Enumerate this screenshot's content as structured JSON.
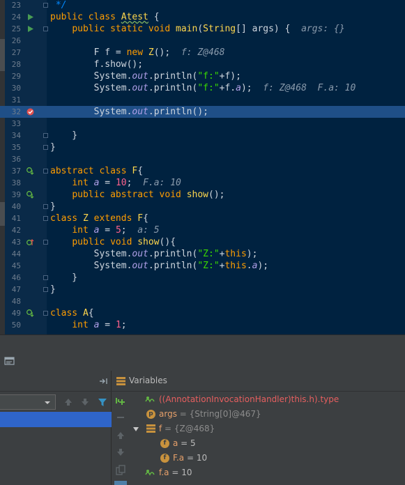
{
  "editor": {
    "lines": [
      {
        "n": "23",
        "code": [
          [
            "c",
            " */"
          ]
        ]
      },
      {
        "n": "24",
        "code": [
          [
            "k",
            "public class "
          ],
          [
            "w",
            "Atest"
          ],
          [
            "p",
            " {"
          ]
        ]
      },
      {
        "n": "25",
        "code": [
          [
            "p",
            "    "
          ],
          [
            "k",
            "public static void "
          ],
          [
            "f",
            "main"
          ],
          [
            "p",
            "("
          ],
          [
            "t",
            "String"
          ],
          [
            "p",
            "[] args) {  "
          ],
          [
            "h",
            "args: {}"
          ]
        ]
      },
      {
        "n": "26",
        "code": []
      },
      {
        "n": "27",
        "code": [
          [
            "p",
            "        F f = "
          ],
          [
            "k",
            "new "
          ],
          [
            "t",
            "Z"
          ],
          [
            "p",
            "();  "
          ],
          [
            "h",
            "f: Z@468"
          ]
        ]
      },
      {
        "n": "28",
        "code": [
          [
            "p",
            "        f.show();"
          ]
        ]
      },
      {
        "n": "29",
        "code": [
          [
            "p",
            "        System."
          ],
          [
            "o",
            "out"
          ],
          [
            "p",
            ".println("
          ],
          [
            "s",
            "\"f:\""
          ],
          [
            "p",
            "+f);"
          ]
        ]
      },
      {
        "n": "30",
        "code": [
          [
            "p",
            "        System."
          ],
          [
            "o",
            "out"
          ],
          [
            "p",
            ".println("
          ],
          [
            "s",
            "\"f:\""
          ],
          [
            "p",
            "+f."
          ],
          [
            "o",
            "a"
          ],
          [
            "p",
            ");  "
          ],
          [
            "h",
            "f: Z@468  F.a: 10"
          ]
        ]
      },
      {
        "n": "31",
        "code": []
      },
      {
        "n": "32",
        "code": [
          [
            "p",
            "        System."
          ],
          [
            "o",
            "out"
          ],
          [
            "p",
            ".println();"
          ]
        ]
      },
      {
        "n": "33",
        "code": []
      },
      {
        "n": "34",
        "code": [
          [
            "p",
            "    }"
          ]
        ]
      },
      {
        "n": "35",
        "code": [
          [
            "p",
            "}"
          ]
        ]
      },
      {
        "n": "36",
        "code": []
      },
      {
        "n": "37",
        "code": [
          [
            "k",
            "abstract class "
          ],
          [
            "t",
            "F"
          ],
          [
            "p",
            "{"
          ]
        ]
      },
      {
        "n": "38",
        "code": [
          [
            "p",
            "    "
          ],
          [
            "k",
            "int "
          ],
          [
            "o",
            "a"
          ],
          [
            "p",
            " = "
          ],
          [
            "n",
            "10"
          ],
          [
            "p",
            ";  "
          ],
          [
            "h",
            "F.a: 10"
          ]
        ]
      },
      {
        "n": "39",
        "code": [
          [
            "p",
            "    "
          ],
          [
            "k",
            "public abstract void "
          ],
          [
            "f",
            "show"
          ],
          [
            "p",
            "();"
          ]
        ]
      },
      {
        "n": "40",
        "code": [
          [
            "p",
            "}"
          ]
        ]
      },
      {
        "n": "41",
        "code": [
          [
            "k",
            "class "
          ],
          [
            "t",
            "Z "
          ],
          [
            "k",
            "extends "
          ],
          [
            "t",
            "F"
          ],
          [
            "p",
            "{"
          ]
        ]
      },
      {
        "n": "42",
        "code": [
          [
            "p",
            "    "
          ],
          [
            "k",
            "int "
          ],
          [
            "o",
            "a"
          ],
          [
            "p",
            " = "
          ],
          [
            "n",
            "5"
          ],
          [
            "p",
            ";  "
          ],
          [
            "h",
            "a: 5"
          ]
        ]
      },
      {
        "n": "43",
        "code": [
          [
            "p",
            "    "
          ],
          [
            "k",
            "public void "
          ],
          [
            "f",
            "show"
          ],
          [
            "p",
            "(){"
          ]
        ]
      },
      {
        "n": "44",
        "code": [
          [
            "p",
            "        System."
          ],
          [
            "o",
            "out"
          ],
          [
            "p",
            ".println("
          ],
          [
            "s",
            "\"Z:\""
          ],
          [
            "p",
            "+"
          ],
          [
            "k",
            "this"
          ],
          [
            "p",
            ");"
          ]
        ]
      },
      {
        "n": "45",
        "code": [
          [
            "p",
            "        System."
          ],
          [
            "o",
            "out"
          ],
          [
            "p",
            ".println("
          ],
          [
            "s",
            "\"Z:\""
          ],
          [
            "p",
            "+"
          ],
          [
            "k",
            "this"
          ],
          [
            "p",
            "."
          ],
          [
            "o",
            "a"
          ],
          [
            "p",
            ");"
          ]
        ]
      },
      {
        "n": "46",
        "code": [
          [
            "p",
            "    }"
          ]
        ]
      },
      {
        "n": "47",
        "code": [
          [
            "p",
            "}"
          ]
        ]
      },
      {
        "n": "48",
        "code": []
      },
      {
        "n": "49",
        "code": [
          [
            "k",
            "class "
          ],
          [
            "t",
            "A"
          ],
          [
            "p",
            "{"
          ]
        ]
      },
      {
        "n": "50",
        "code": [
          [
            "p",
            "    "
          ],
          [
            "k",
            "int "
          ],
          [
            "o",
            "a"
          ],
          [
            "p",
            " = "
          ],
          [
            "n",
            "1"
          ],
          [
            "p",
            ";"
          ]
        ]
      }
    ]
  },
  "variables": {
    "title": "Variables",
    "rows": [
      {
        "name": "((AnnotationInvocationHandler)this.h).type",
        "value": ""
      },
      {
        "name": "args",
        "value": " = {String[0]@467}"
      },
      {
        "name": "f",
        "value": " = {Z@468}"
      },
      {
        "name": "a",
        "value": " = 5"
      },
      {
        "name": "F.a",
        "value": " = 10"
      },
      {
        "name": "f.a",
        "value": " = 10"
      }
    ]
  },
  "colors": {
    "editor_bg": "#002240",
    "current_line": "#1f4f87",
    "breakpoint": "#e0504f",
    "panel_bg": "#3c3f41",
    "selection": "#2f65ca"
  }
}
